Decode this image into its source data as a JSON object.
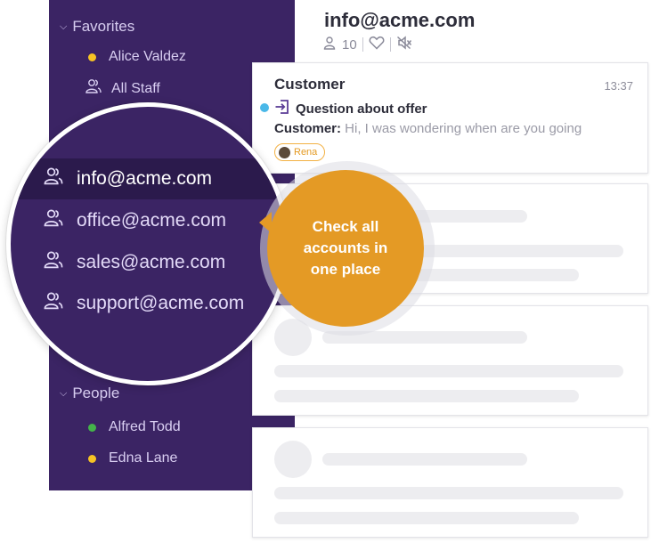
{
  "sidebar": {
    "favorites_title": "Favorites",
    "favorites": [
      {
        "label": "Alice Valdez",
        "status": "yellow"
      },
      {
        "label": "All Staff",
        "icon": "people-icon"
      }
    ],
    "people_title": "People",
    "people": [
      {
        "label": "Alfred Todd",
        "status": "green"
      },
      {
        "label": "Edna Lane",
        "status": "yellow"
      }
    ]
  },
  "magnifier": {
    "accounts": [
      {
        "label": "info@acme.com",
        "active": true
      },
      {
        "label": "office@acme.com"
      },
      {
        "label": "sales@acme.com"
      },
      {
        "label": "support@acme.com"
      }
    ]
  },
  "header": {
    "title": "info@acme.com",
    "member_count": "10"
  },
  "conversation": {
    "customer": "Customer",
    "time": "13:37",
    "subject": "Question about offer",
    "preview_label": "Customer:",
    "preview_text": " Hi, I was wondering when are you going",
    "tag": "Rena"
  },
  "callout": {
    "text": "Check all accounts in one place"
  },
  "colors": {
    "sidebar": "#3b2464",
    "active_row": "#2b1a4c",
    "callout": "#e49a25",
    "unread": "#4ab8e8"
  }
}
